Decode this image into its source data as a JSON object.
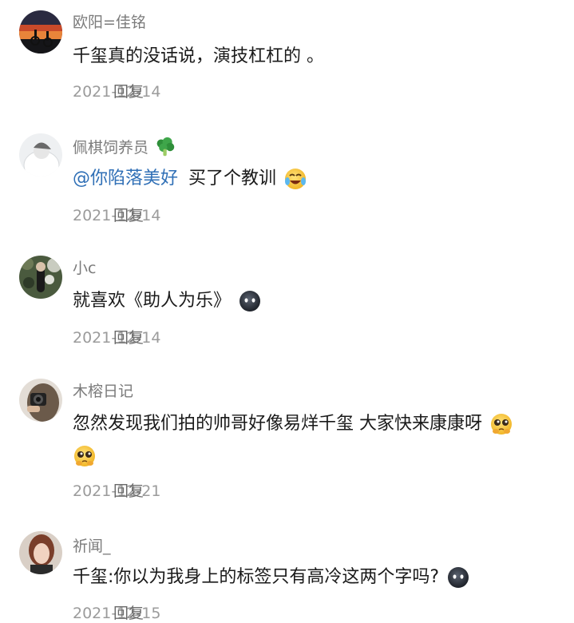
{
  "comments": [
    {
      "username": "欧阳=佳铭",
      "content": "千玺真的没话说，演技杠杠的 。",
      "date": "2021-12-14",
      "reply_label": "回复",
      "avatar": "avatar-sunset-cyclists"
    },
    {
      "username": "佩棋饲养员",
      "username_emoji": "broccoli-emoji",
      "mention": "@你陷落美好",
      "content": "买了个教训",
      "content_emoji": "crying-laughing-emoji",
      "date": "2021-12-14",
      "reply_label": "回复",
      "avatar": "avatar-white-veil"
    },
    {
      "username": "小c",
      "content": "就喜欢《助人为乐》",
      "content_emoji": "dark-face-emoji",
      "date": "2021-12-14",
      "reply_label": "回复",
      "avatar": "avatar-garden-portrait"
    },
    {
      "username": "木榕日记",
      "content": "忽然发现我们拍的帅哥好像易烊千玺 大家快来康康呀",
      "content_emoji": "pleading-face-emoji",
      "content_line2_emoji": "pleading-face-emoji",
      "date": "2021-12-21",
      "reply_label": "回复",
      "avatar": "avatar-camera-selfie"
    },
    {
      "username": "祈闻_",
      "content": "千玺:你以为我身上的标签只有高冷这两个字吗?",
      "content_emoji": "dark-face-emoji",
      "date": "2021-12-15",
      "reply_label": "回复",
      "avatar": "avatar-portrait-woman"
    }
  ],
  "colors": {
    "mention": "#2f6fb6",
    "username": "#7b7b7b",
    "meta": "#9b9b9b",
    "text": "#1a1a1a"
  }
}
